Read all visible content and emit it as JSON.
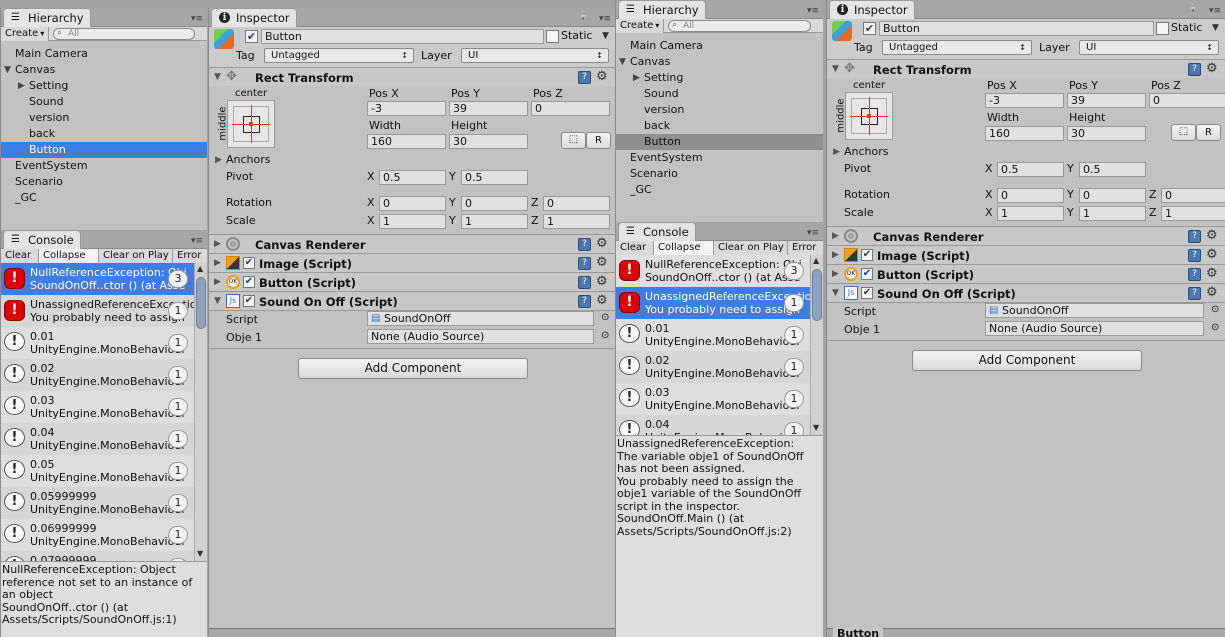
{
  "colors": {
    "selection_focused": "#3e7de7",
    "selection_unfocused": "#8f8f8f",
    "error": "#dd0000",
    "panel": "#c2c2c2"
  },
  "screens": [
    {
      "hierarchy": {
        "title": "Hierarchy",
        "create": "Create",
        "search_placeholder": "All",
        "selection": "focused",
        "items": [
          {
            "label": "Main Camera",
            "depth": 0,
            "arrow": ""
          },
          {
            "label": "Canvas",
            "depth": 0,
            "arrow": "down"
          },
          {
            "label": "Setting",
            "depth": 1,
            "arrow": "right"
          },
          {
            "label": "Sound",
            "depth": 1,
            "arrow": ""
          },
          {
            "label": "version",
            "depth": 1,
            "arrow": ""
          },
          {
            "label": "back",
            "depth": 1,
            "arrow": ""
          },
          {
            "label": "Button",
            "depth": 1,
            "arrow": "",
            "selected": true
          },
          {
            "label": "EventSystem",
            "depth": 0,
            "arrow": ""
          },
          {
            "label": "Scenario",
            "depth": 0,
            "arrow": ""
          },
          {
            "label": "_GC",
            "depth": 0,
            "arrow": ""
          }
        ]
      },
      "console": {
        "title": "Console",
        "buttons": [
          "Clear",
          "Collapse",
          "Clear on Play",
          "Error"
        ],
        "active_button": "Collapse",
        "entries": [
          {
            "type": "error",
            "line1": "NullReferenceException: Obj",
            "line2": "SoundOnOff..ctor () (at Asse",
            "count": "3",
            "selected": true
          },
          {
            "type": "error",
            "line1": "UnassignedReferenceException",
            "line2": "You probably need to assign",
            "count": "1"
          },
          {
            "type": "log",
            "line1": "0.01",
            "line2": "UnityEngine.MonoBehaviour",
            "count": "1"
          },
          {
            "type": "log",
            "line1": "0.02",
            "line2": "UnityEngine.MonoBehaviour",
            "count": "1"
          },
          {
            "type": "log",
            "line1": "0.03",
            "line2": "UnityEngine.MonoBehaviour",
            "count": "1"
          },
          {
            "type": "log",
            "line1": "0.04",
            "line2": "UnityEngine.MonoBehaviour",
            "count": "1"
          },
          {
            "type": "log",
            "line1": "0.05",
            "line2": "UnityEngine.MonoBehaviour",
            "count": "1"
          },
          {
            "type": "log",
            "line1": "0.05999999",
            "line2": "UnityEngine.MonoBehaviour",
            "count": "1"
          },
          {
            "type": "log",
            "line1": "0.06999999",
            "line2": "UnityEngine.MonoBehaviour",
            "count": "1"
          },
          {
            "type": "log",
            "line1": "0.07999999",
            "line2": "UnityEngine.MonoBehaviour",
            "count": "1"
          }
        ],
        "details": "NullReferenceException: Object\nreference not set to an instance of\nan object\nSoundOnOff..ctor () (at\nAssets/Scripts/SoundOnOff.js:1)"
      },
      "inspector": {
        "title": "Inspector",
        "preview_label": ""
      }
    },
    {
      "hierarchy": {
        "title": "Hierarchy",
        "create": "Create",
        "search_placeholder": "All",
        "selection": "unfocused",
        "items": [
          {
            "label": "Main Camera",
            "depth": 0,
            "arrow": ""
          },
          {
            "label": "Canvas",
            "depth": 0,
            "arrow": "down"
          },
          {
            "label": "Setting",
            "depth": 1,
            "arrow": "right"
          },
          {
            "label": "Sound",
            "depth": 1,
            "arrow": ""
          },
          {
            "label": "version",
            "depth": 1,
            "arrow": ""
          },
          {
            "label": "back",
            "depth": 1,
            "arrow": ""
          },
          {
            "label": "Button",
            "depth": 1,
            "arrow": "",
            "selected": true
          },
          {
            "label": "EventSystem",
            "depth": 0,
            "arrow": ""
          },
          {
            "label": "Scenario",
            "depth": 0,
            "arrow": ""
          },
          {
            "label": "_GC",
            "depth": 0,
            "arrow": ""
          }
        ]
      },
      "console": {
        "title": "Console",
        "buttons": [
          "Clear",
          "Collapse",
          "Clear on Play",
          "Error"
        ],
        "active_button": "Collapse",
        "entries": [
          {
            "type": "error",
            "line1": "NullReferenceException: Obj",
            "line2": "SoundOnOff..ctor () (at Asse",
            "count": "3"
          },
          {
            "type": "error",
            "line1": "UnassignedReferenceException",
            "line2": "You probably need to assign",
            "count": "1",
            "selected": true
          },
          {
            "type": "log",
            "line1": "0.01",
            "line2": "UnityEngine.MonoBehaviour",
            "count": "1"
          },
          {
            "type": "log",
            "line1": "0.02",
            "line2": "UnityEngine.MonoBehaviour",
            "count": "1"
          },
          {
            "type": "log",
            "line1": "0.03",
            "line2": "UnityEngine.MonoBehaviour",
            "count": "1"
          },
          {
            "type": "log",
            "line1": "0.04",
            "line2": "UnityEngine.MonoBehaviour",
            "count": "1"
          }
        ],
        "details": "UnassignedReferenceException:\nThe variable obje1 of SoundOnOff\nhas not been assigned.\nYou probably need to assign the\nobje1 variable of the SoundOnOff\nscript in the inspector.\nSoundOnOff.Main () (at\nAssets/Scripts/SoundOnOff.js:2)"
      },
      "inspector": {
        "title": "Inspector",
        "preview_label": "Button"
      }
    }
  ],
  "object": {
    "name": "Button",
    "active": true,
    "static_label": "Static",
    "static": false,
    "tag_label": "Tag",
    "tag": "Untagged",
    "layer_label": "Layer",
    "layer": "UI",
    "rect_transform": {
      "title": "Rect Transform",
      "anchor_h": "center",
      "anchor_v": "middle",
      "pos_x_label": "Pos X",
      "pos_y_label": "Pos Y",
      "pos_z_label": "Pos Z",
      "pos_x": "-3",
      "pos_y": "39",
      "pos_z": "0",
      "width_label": "Width",
      "height_label": "Height",
      "width": "160",
      "height": "30",
      "raw_button": "R",
      "anchors_label": "Anchors",
      "pivot_label": "Pivot",
      "pivot_x": "0.5",
      "pivot_y": "0.5",
      "rotation_label": "Rotation",
      "rot_x": "0",
      "rot_y": "0",
      "rot_z": "0",
      "scale_label": "Scale",
      "scale_x": "1",
      "scale_y": "1",
      "scale_z": "1",
      "x": "X",
      "y": "Y",
      "z": "Z"
    },
    "components": [
      {
        "title": "Canvas Renderer",
        "icon": "canvas-renderer-icon",
        "checkbox": false
      },
      {
        "title": "Image (Script)",
        "icon": "image-icon",
        "checkbox": true
      },
      {
        "title": "Button (Script)",
        "icon": "button-ok-icon",
        "checkbox": true
      },
      {
        "title": "Sound On Off (Script)",
        "icon": "js-script-icon",
        "checkbox": true,
        "expanded": true
      }
    ],
    "script_label": "Script",
    "script_value": "SoundOnOff",
    "obje1_label": "Obje 1",
    "obje1_value": "None (Audio Source)",
    "add_component": "Add Component"
  }
}
